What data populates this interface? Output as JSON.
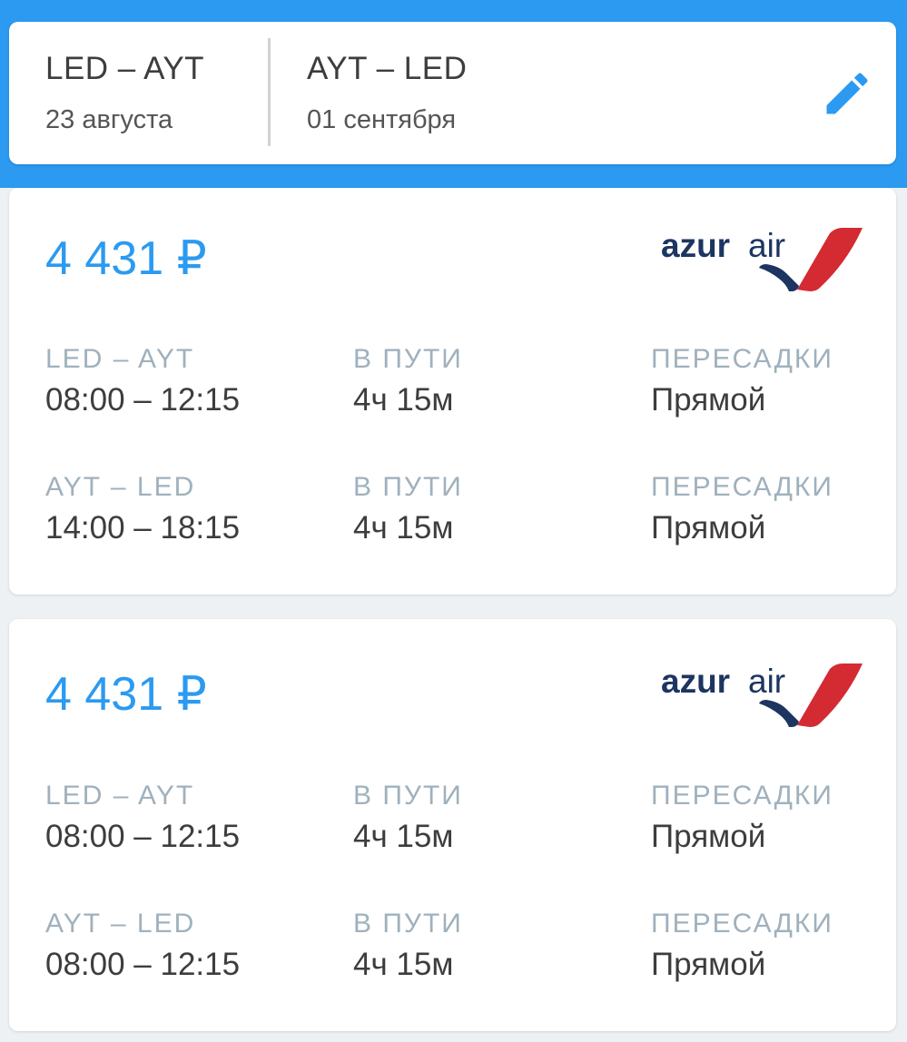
{
  "search": {
    "outbound": {
      "route": "LED – AYT",
      "date": "23 августа"
    },
    "inbound": {
      "route": "AYT – LED",
      "date": "01 сентября"
    },
    "edit_icon": "pencil-icon"
  },
  "colors": {
    "accent": "#2b9af0",
    "label": "#9fb1bd",
    "text": "#3d3d3d",
    "logo_navy": "#1d3560",
    "logo_red": "#d42a32"
  },
  "results": [
    {
      "price": "4 431 ₽",
      "airline": {
        "name_bold": "azur",
        "name_light": "air"
      },
      "legs": [
        {
          "route": "LED – AYT",
          "times": "08:00 – 12:15",
          "duration_label": "В ПУТИ",
          "duration": "4ч 15м",
          "stops_label": "ПЕРЕСАДКИ",
          "stops": "Прямой"
        },
        {
          "route": "AYT – LED",
          "times": "14:00 – 18:15",
          "duration_label": "В ПУТИ",
          "duration": "4ч 15м",
          "stops_label": "ПЕРЕСАДКИ",
          "stops": "Прямой"
        }
      ]
    },
    {
      "price": "4 431 ₽",
      "airline": {
        "name_bold": "azur",
        "name_light": "air"
      },
      "legs": [
        {
          "route": "LED – AYT",
          "times": "08:00 – 12:15",
          "duration_label": "В ПУТИ",
          "duration": "4ч 15м",
          "stops_label": "ПЕРЕСАДКИ",
          "stops": "Прямой"
        },
        {
          "route": "AYT – LED",
          "times": "08:00 – 12:15",
          "duration_label": "В ПУТИ",
          "duration": "4ч 15м",
          "stops_label": "ПЕРЕСАДКИ",
          "stops": "Прямой"
        }
      ]
    }
  ]
}
